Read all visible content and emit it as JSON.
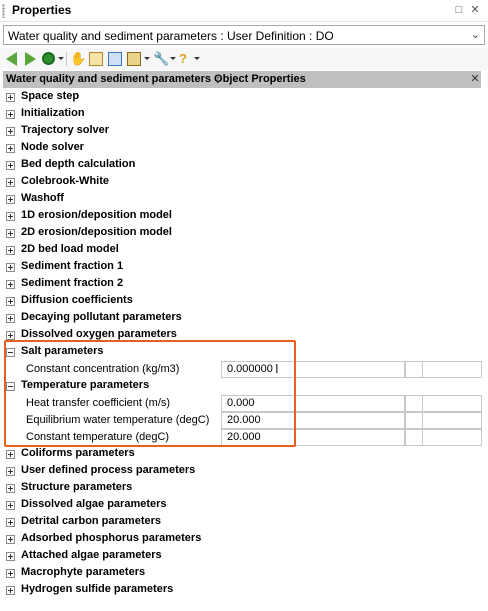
{
  "window": {
    "title": "Properties",
    "pin_icon": "pin-icon",
    "close_icon": "close-icon"
  },
  "combo": {
    "value": "Water quality and sediment parameters : User Definition : DO"
  },
  "toolbar": {
    "icons": [
      "back-arrow-icon",
      "forward-arrow-icon",
      "globe-icon",
      "hand-icon",
      "document-icon",
      "image-icon",
      "list-icon",
      "wrench-icon",
      "help-icon"
    ]
  },
  "header": {
    "title": "Water quality and sediment parameters Object Properties"
  },
  "categories_top": [
    "Space step",
    "Initialization",
    "Trajectory solver",
    "Node solver",
    "Bed depth calculation",
    "Colebrook-White",
    "Washoff",
    "1D erosion/deposition model",
    "2D erosion/deposition model",
    "2D bed load model",
    "Sediment fraction 1",
    "Sediment fraction 2",
    "Diffusion coefficients",
    "Decaying pollutant parameters",
    "Dissolved oxygen parameters"
  ],
  "salt": {
    "title": "Salt parameters",
    "props": [
      {
        "label": "Constant concentration (kg/m3)",
        "value": "0.000000"
      }
    ]
  },
  "temperature": {
    "title": "Temperature parameters",
    "props": [
      {
        "label": "Heat transfer coefficient (m/s)",
        "value": "0.000"
      },
      {
        "label": "Equilibrium water temperature (degC)",
        "value": "20.000"
      },
      {
        "label": "Constant temperature (degC)",
        "value": "20.000"
      }
    ]
  },
  "categories_bottom": [
    "Coliforms parameters",
    "User defined process parameters",
    "Structure parameters",
    "Dissolved algae parameters",
    "Detrital carbon parameters",
    "Adsorbed phosphorus parameters",
    "Attached algae parameters",
    "Macrophyte parameters",
    "Hydrogen sulfide parameters"
  ],
  "colors": {
    "highlight": "#e8601c",
    "header_bg": "#bfbfbf",
    "arrow_green": "#5aa63a"
  }
}
